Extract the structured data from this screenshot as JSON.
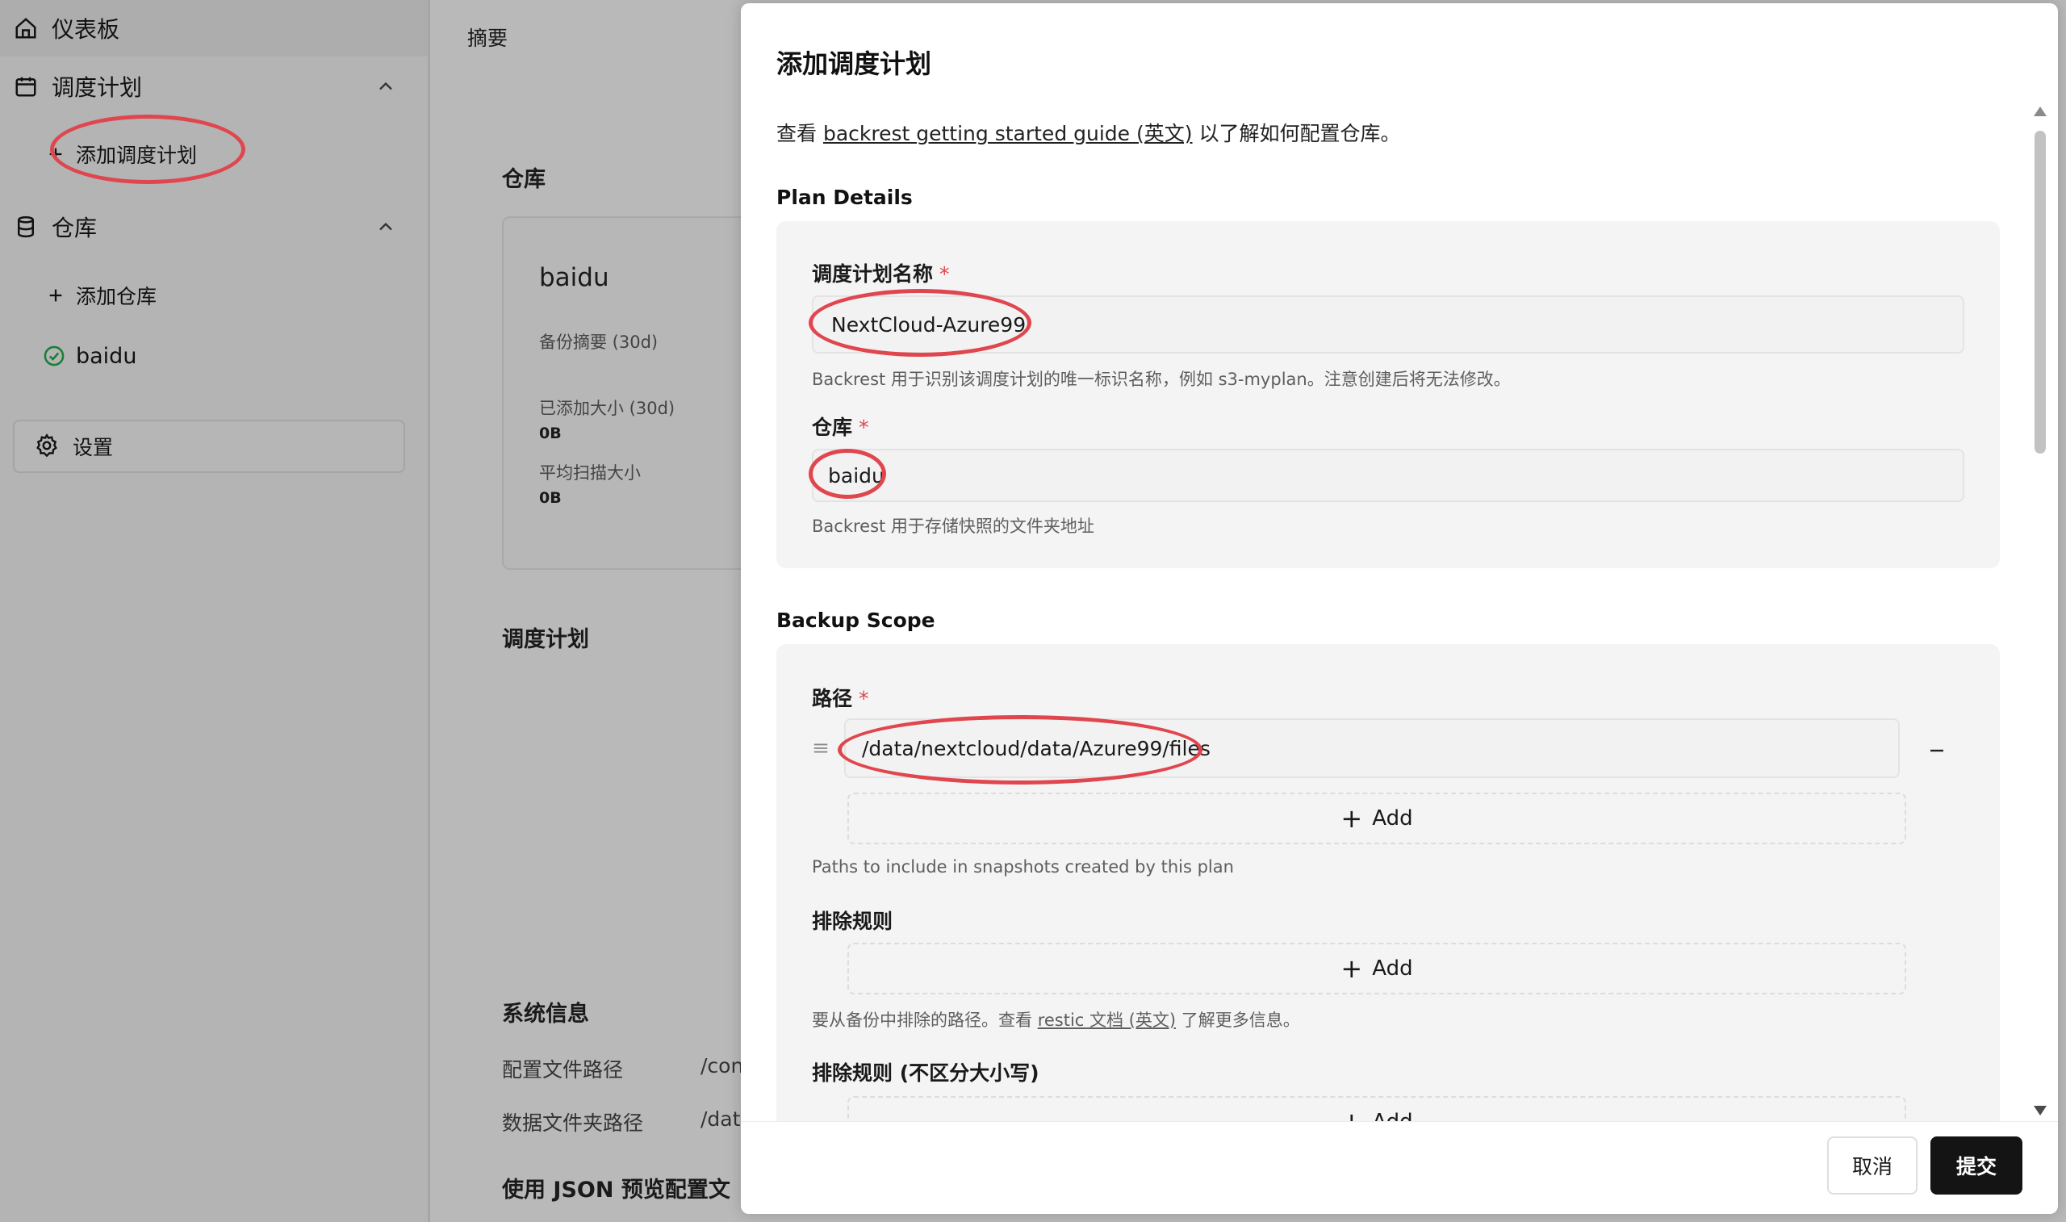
{
  "sidebar": {
    "dashboard": "仪表板",
    "plans": "调度计划",
    "add_plan": "添加调度计划",
    "repos": "仓库",
    "add_repo": "添加仓库",
    "repo_baidu": "baidu",
    "settings": "设置"
  },
  "main": {
    "summary_tab": "摘要",
    "repos_heading": "仓库",
    "repo_card": {
      "name": "baidu",
      "backup_summary": "备份摘要 (30d)",
      "added_size_label": "已添加大小 (30d)",
      "added_size_value": "0B",
      "avg_scan_label": "平均扫描大小",
      "avg_scan_value": "0B"
    },
    "plans_heading": "调度计划",
    "sysinfo_heading": "系统信息",
    "config_path_label": "配置文件路径",
    "config_path_value": "/con",
    "data_path_label": "数据文件夹路径",
    "data_path_value": "/dat",
    "json_preview": "使用 JSON 预览配置文"
  },
  "modal": {
    "title": "添加调度计划",
    "intro_prefix": "查看 ",
    "intro_link": "backrest getting started guide (英文)",
    "intro_suffix": " 以了解如何配置仓库。",
    "plan_details_title": "Plan Details",
    "plan_name_label": "调度计划名称",
    "required_mark": "*",
    "plan_name_value": "NextCloud-Azure99",
    "plan_name_help": "Backrest 用于识别该调度计划的唯一标识名称，例如 s3-myplan。注意创建后将无法修改。",
    "repo_label": "仓库",
    "repo_value": "baidu",
    "repo_help": "Backrest 用于存储快照的文件夹地址",
    "backup_scope_title": "Backup Scope",
    "paths_label": "路径",
    "path_value": "/data/nextcloud/data/Azure99/files",
    "add_label": "Add",
    "paths_help": "Paths to include in snapshots created by this plan",
    "excludes_label": "排除规则",
    "excludes_help_prefix": "要从备份中排除的路径。查看 ",
    "excludes_help_link": "restic 文档 (英文)",
    "excludes_help_suffix": " 了解更多信息。",
    "iexcludes_label": "排除规则 (不区分大小写)",
    "cancel": "取消",
    "submit": "提交"
  },
  "colors": {
    "annotation_ring": "#e0464e",
    "success_check": "#1a7f37",
    "primary_button": "#141414",
    "overlay_dim": "#b9b9b9"
  }
}
